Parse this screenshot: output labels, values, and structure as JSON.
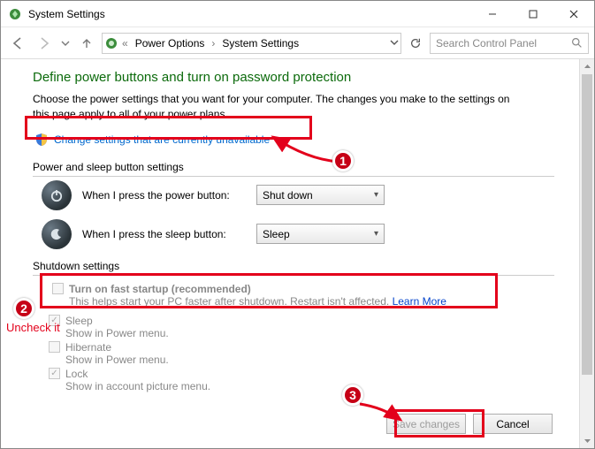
{
  "window": {
    "title": "System Settings",
    "min": "—",
    "max": "□",
    "close": "✕"
  },
  "nav": {
    "breadcrumb": [
      "Power Options",
      "System Settings"
    ],
    "search_placeholder": "Search Control Panel"
  },
  "page": {
    "heading": "Define power buttons and turn on password protection",
    "description": "Choose the power settings that you want for your computer. The changes you make to the settings on this page apply to all of your power plans.",
    "change_link": "Change settings that are currently unavailable",
    "section_buttons_title": "Power and sleep button settings",
    "row_power_label": "When I press the power button:",
    "row_power_value": "Shut down",
    "row_sleep_label": "When I press the sleep button:",
    "row_sleep_value": "Sleep",
    "section_shutdown_title": "Shutdown settings",
    "fast_label": "Turn on fast startup (recommended)",
    "fast_desc": "This helps start your PC faster after shutdown. Restart isn't affected. ",
    "learn_more": "Learn More",
    "sleep_label": "Sleep",
    "sleep_desc": "Show in Power menu.",
    "hibernate_label": "Hibernate",
    "hibernate_desc": "Show in Power menu.",
    "lock_label": "Lock",
    "lock_desc": "Show in account picture menu."
  },
  "buttons": {
    "save": "Save changes",
    "cancel": "Cancel"
  },
  "annotations": {
    "n1": "1",
    "n2": "2",
    "n3": "3",
    "uncheck": "Uncheck it"
  }
}
